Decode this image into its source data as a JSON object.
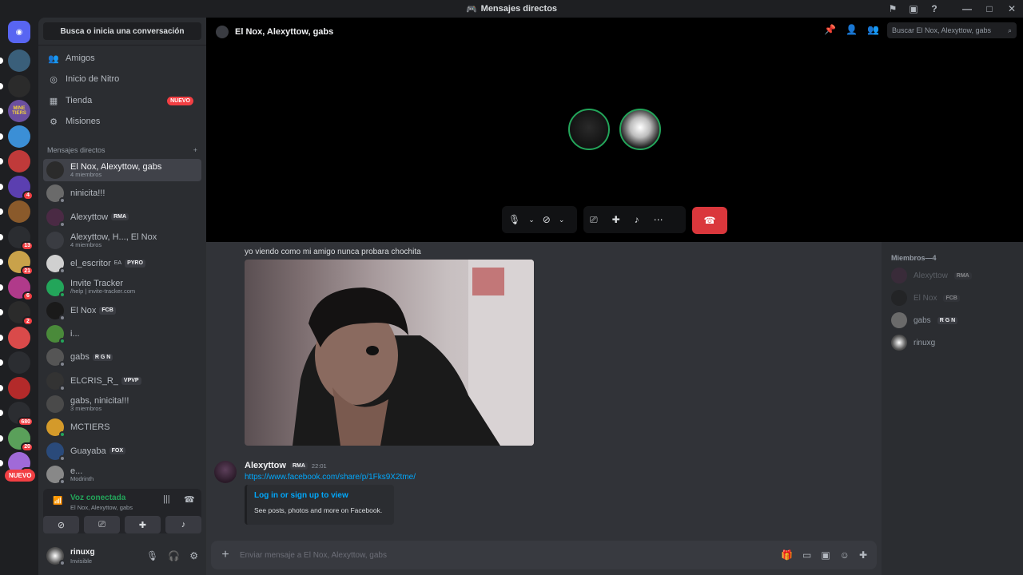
{
  "window": {
    "title": "Mensajes directos"
  },
  "servers": [
    {
      "badge": ""
    },
    {
      "badge": ""
    },
    {
      "label": "MINE TIERS",
      "badge": ""
    },
    {
      "badge": ""
    },
    {
      "badge": ""
    },
    {
      "badge": "4"
    },
    {
      "badge": ""
    },
    {
      "badge": "13"
    },
    {
      "badge": "21"
    },
    {
      "badge": "6"
    },
    {
      "badge": "2"
    },
    {
      "badge": ""
    },
    {
      "badge": ""
    },
    {
      "badge": ""
    },
    {
      "badge": "680"
    },
    {
      "badge": "20"
    },
    {
      "badge": "70"
    }
  ],
  "rail_new_label": "NUEVO",
  "sidebar": {
    "search_label": "Busca o inicia una conversación",
    "nav": [
      {
        "label": "Amigos",
        "icon": "friends-icon"
      },
      {
        "label": "Inicio de Nitro",
        "icon": "nitro-icon"
      },
      {
        "label": "Tienda",
        "icon": "shop-icon",
        "badge": "NUEVO"
      },
      {
        "label": "Misiones",
        "icon": "quests-icon"
      }
    ],
    "dm_header": "Mensajes directos",
    "dms": [
      {
        "name": "El Nox, Alexyttow, gabs",
        "sub": "4 miembros",
        "tag": "",
        "active": true
      },
      {
        "name": "ninicita!!!",
        "sub": "",
        "tag": ""
      },
      {
        "name": "Alexyttow",
        "sub": "",
        "tag": "RMA"
      },
      {
        "name": "Alexyttow, H..., El Nox",
        "sub": "4 miembros",
        "tag": ""
      },
      {
        "name": "el_escritor",
        "sub": "",
        "tag": "PYRO",
        "extra": "EA"
      },
      {
        "name": "Invite Tracker",
        "sub": "/help | invite-tracker.com",
        "tag": ""
      },
      {
        "name": "El Nox",
        "sub": "",
        "tag": "FCB"
      },
      {
        "name": "i...",
        "sub": "",
        "tag": ""
      },
      {
        "name": "gabs",
        "sub": "",
        "tag": "R G N"
      },
      {
        "name": "ELCRIS_R_",
        "sub": "",
        "tag": "VPVP"
      },
      {
        "name": "gabs, ninicita!!!",
        "sub": "3 miembros",
        "tag": ""
      },
      {
        "name": "MCTIERS",
        "sub": "",
        "tag": ""
      },
      {
        "name": "Guayaba",
        "sub": "",
        "tag": "FOX"
      },
      {
        "name": "e...",
        "sub": "Modrinth",
        "tag": ""
      }
    ],
    "voice": {
      "status": "Voz conectada",
      "channel": "El Nox, Alexyttow, gabs"
    },
    "user": {
      "name": "rinuxg",
      "status": "Invisible"
    }
  },
  "call": {
    "title": "El Nox, Alexyttow, gabs",
    "search_placeholder": "Buscar El Nox, Alexyttow, gabs"
  },
  "chat": {
    "caption": "yo viendo como mi amigo nunca probara chochita",
    "message": {
      "author": "Alexyttow",
      "tag": "RMA",
      "time": "22:01",
      "link": "https://www.facebook.com/share/p/1Fks9X2tme/",
      "embed_title": "Log in or sign up to view",
      "embed_desc": "See posts, photos and more on Facebook."
    },
    "composer_placeholder": "Enviar mensaje a El Nox, Alexyttow, gabs"
  },
  "members": {
    "header": "Miembros—4",
    "list": [
      {
        "name": "Alexyttow",
        "tag": "RMA",
        "dim": true
      },
      {
        "name": "El Nox",
        "tag": "FCB",
        "dim": true
      },
      {
        "name": "gabs",
        "tag": "R G N",
        "dim": false
      },
      {
        "name": "rinuxg",
        "tag": "",
        "dim": false
      }
    ]
  },
  "colors": {
    "accent_green": "#23a55a",
    "danger_red": "#da373c",
    "link_blue": "#00a8fc"
  }
}
